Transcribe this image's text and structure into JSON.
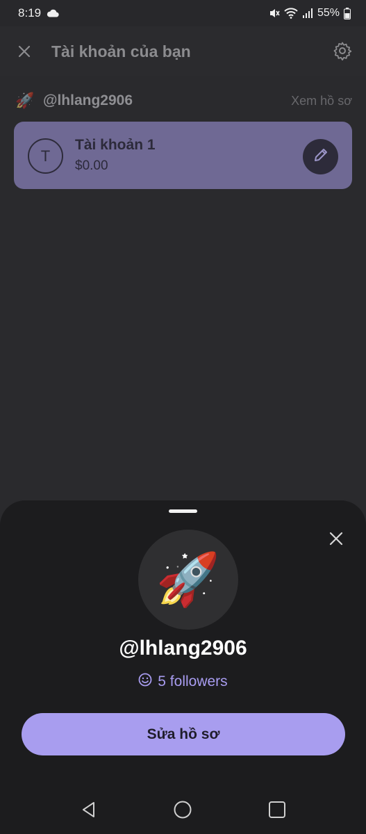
{
  "status_bar": {
    "time": "8:19",
    "battery": "55%",
    "icons": [
      "cloud-icon",
      "mute-icon",
      "wifi-icon",
      "signal-icon",
      "battery-icon"
    ]
  },
  "header": {
    "title": "Tài khoản của bạn",
    "close_icon": "close-icon",
    "settings_icon": "gear-icon"
  },
  "profile": {
    "handle": "@lhlang2906",
    "view_profile_label": "Xem hồ sơ",
    "avatar_emoji": "🚀"
  },
  "account": {
    "initial": "T",
    "name": "Tài khoản 1",
    "balance": "$0.00",
    "card_color": "#6f6994"
  },
  "sheet": {
    "avatar_emoji": "🚀",
    "handle": "@lhlang2906",
    "followers_label": "5 followers",
    "edit_button_label": "Sửa hồ sơ",
    "accent_color": "#a89def"
  },
  "nav_bar": {
    "icons": [
      "back-icon",
      "home-icon",
      "recents-icon"
    ]
  }
}
